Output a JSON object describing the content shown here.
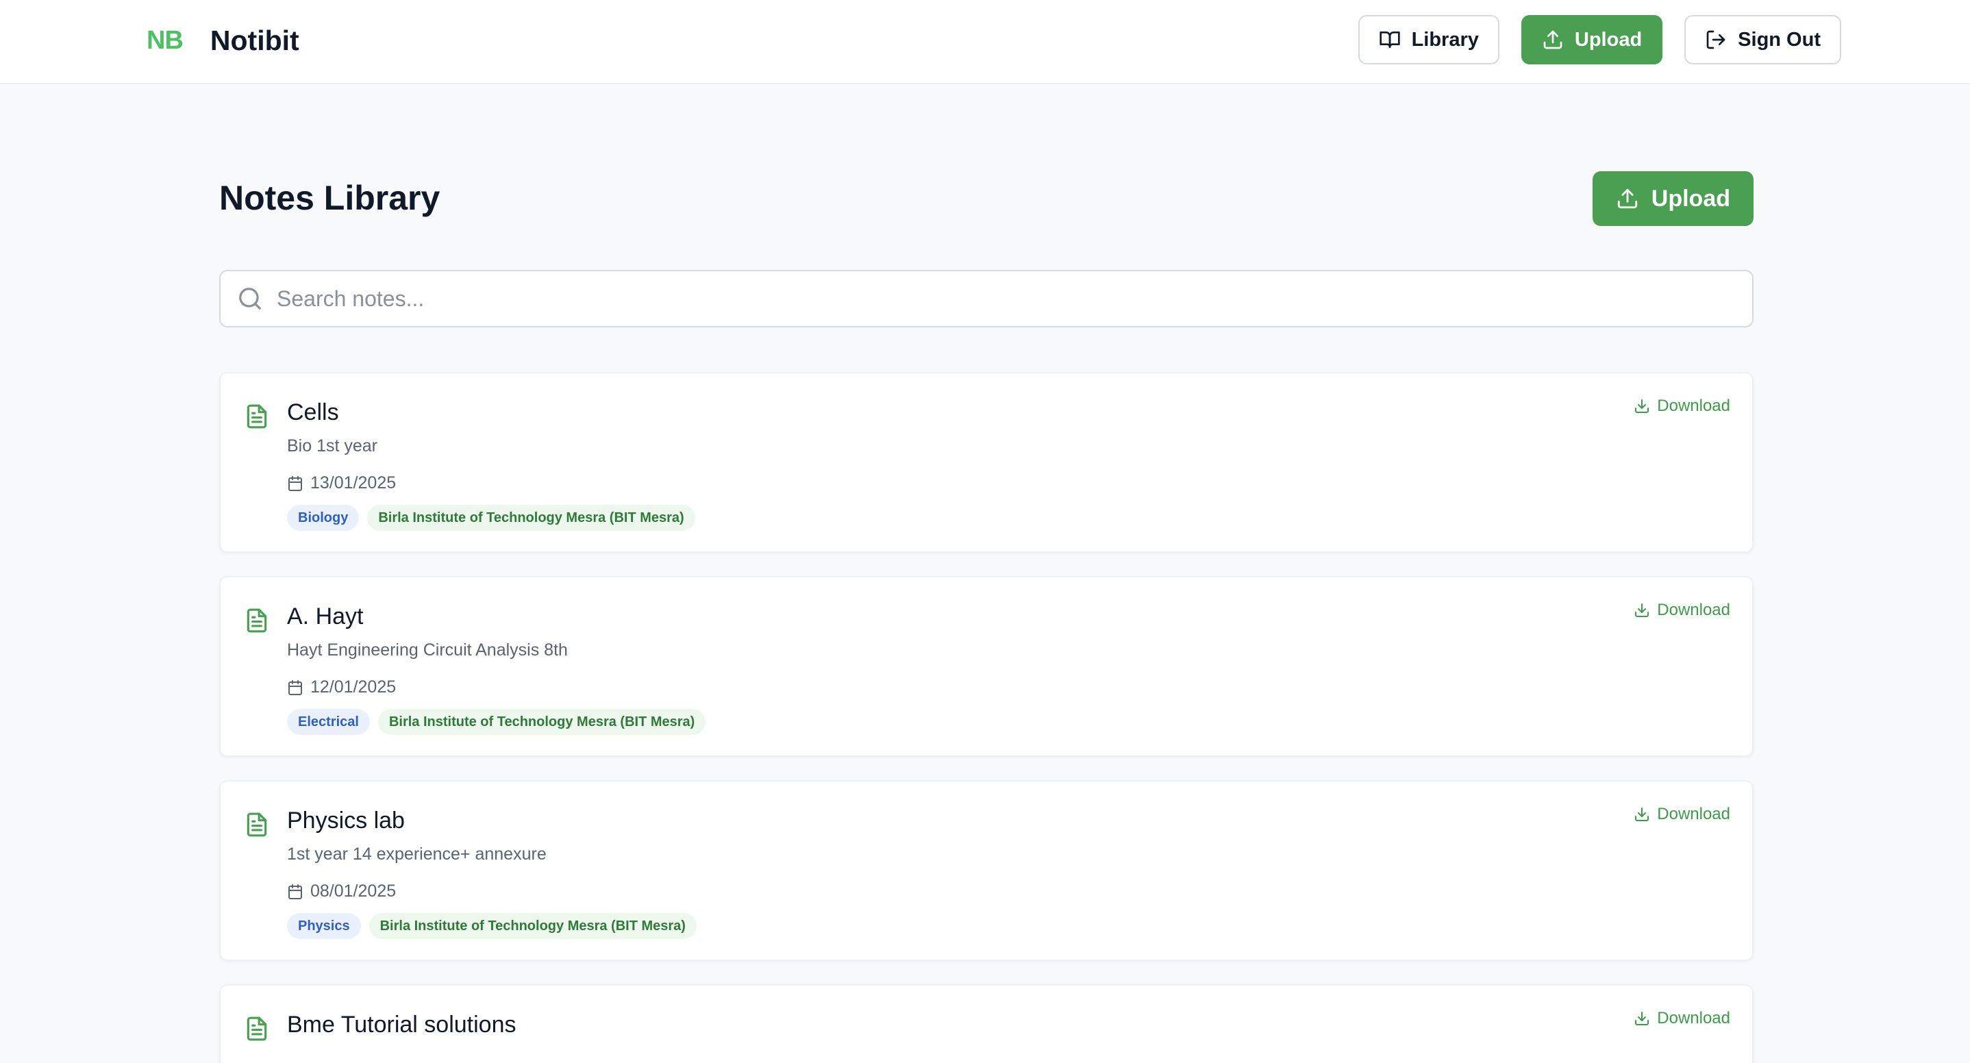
{
  "header": {
    "logo": "NB",
    "app_name": "Notibit",
    "nav": {
      "library_label": "Library",
      "upload_label": "Upload",
      "signout_label": "Sign Out"
    }
  },
  "main": {
    "title": "Notes Library",
    "upload_label": "Upload",
    "search": {
      "placeholder": "Search notes...",
      "value": ""
    }
  },
  "notes": [
    {
      "title": "Cells",
      "description": "Bio 1st year",
      "date": "13/01/2025",
      "subject": "Biology",
      "institute": "Birla Institute of Technology Mesra (BIT Mesra)",
      "download_label": "Download"
    },
    {
      "title": "A. Hayt",
      "description": "Hayt Engineering Circuit Analysis 8th",
      "date": "12/01/2025",
      "subject": "Electrical",
      "institute": "Birla Institute of Technology Mesra (BIT Mesra)",
      "download_label": "Download"
    },
    {
      "title": "Physics lab",
      "description": "1st year 14 experience+ annexure",
      "date": "08/01/2025",
      "subject": "Physics",
      "institute": "Birla Institute of Technology Mesra (BIT Mesra)",
      "download_label": "Download"
    },
    {
      "title": "Bme Tutorial solutions",
      "download_label": "Download"
    }
  ],
  "colors": {
    "brand_green": "#4a9f52",
    "logo_green": "#4ec064",
    "tag_blue_text": "#2f5fc2",
    "tag_green_text": "#2f7a38"
  }
}
